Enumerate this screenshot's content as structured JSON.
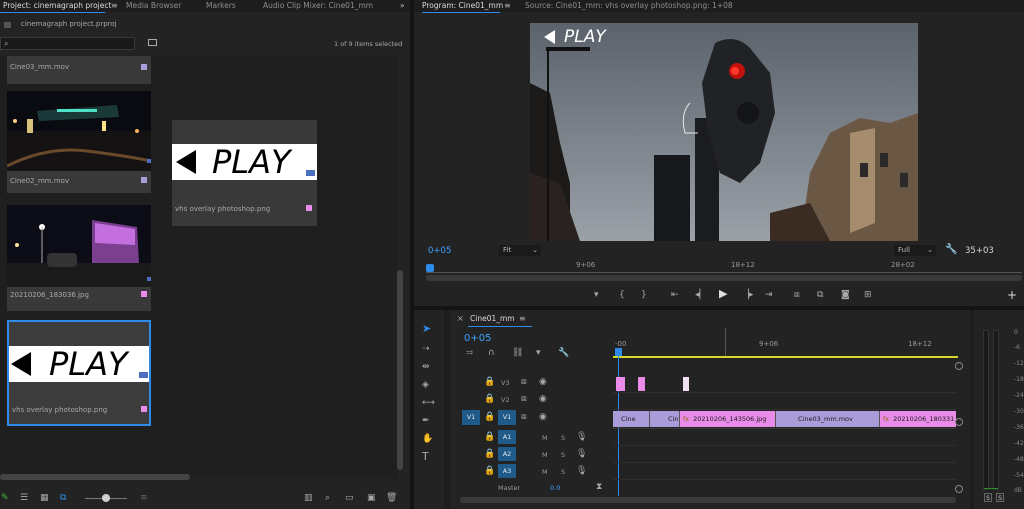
{
  "colors": {
    "accent": "#2d8ceb",
    "pink": "#e98be8",
    "violet": "#a99cd9",
    "timecode": "#3fa2ff",
    "playhead": "#2d8ceb",
    "workarea": "#d6d62b"
  },
  "project": {
    "tabs": [
      "Project: cinemagraph project",
      "Media Browser",
      "Markers",
      "Audio Clip Mixer: Cine01_mm"
    ],
    "more_label": "»",
    "file_name": "cinemagraph project.prproj",
    "search_placeholder": "",
    "items_selected": "1 of 9 items selected",
    "items": [
      {
        "name": "Cine03_mm.mov",
        "color": "#a99cd9",
        "thumb": "cut-off"
      },
      {
        "name": "Cine02_mm.mov",
        "color": "#a99cd9",
        "thumb": "night-street"
      },
      {
        "name": "vhs overlay photoshop.png",
        "color": "#e98be8",
        "thumb": "play-overlay"
      },
      {
        "name": "20210206_183036.jpg",
        "color": "#e98be8",
        "thumb": "purple-building"
      },
      {
        "name": "vhs overlay photoshop.png",
        "color": "#e98be8",
        "thumb": "play-overlay-large",
        "selected": true
      }
    ],
    "play_text": "PLAY"
  },
  "program": {
    "tab": "Program: Cine01_mm",
    "menu_label": "≡",
    "source_tab": "Source: Cine01_mm: vhs overlay photoshop.png: 1+08",
    "play_text": "PLAY",
    "timecode": "0+05",
    "fit": "Fit",
    "quality": "Full",
    "duration": "35+03",
    "ruler": [
      "9+06",
      "18+12",
      "28+02"
    ]
  },
  "timeline": {
    "close_label": "×",
    "tab": "Cine01_mm",
    "menu_label": "≡",
    "timecode": "0+05",
    "ruler": [
      "-00",
      "9+06",
      "18+12"
    ],
    "tracks": [
      {
        "id": "V3",
        "patch": ""
      },
      {
        "id": "V2",
        "patch": ""
      },
      {
        "id": "V1",
        "patch": "V1"
      },
      {
        "id": "A1",
        "patch": ""
      },
      {
        "id": "A2",
        "patch": ""
      },
      {
        "id": "A3",
        "patch": ""
      }
    ],
    "v1_clips": [
      "Cine",
      "Cin",
      "20210206_143506.jpg",
      "Cine03_mm.mov",
      "20210206_180331"
    ],
    "fx_label": "fx",
    "mute": "M",
    "solo": "S",
    "master_label": "Master",
    "master_value": "0.0"
  },
  "meters": {
    "scale": [
      "0",
      "-6",
      "-12",
      "-18",
      "-24",
      "-30",
      "-36",
      "-42",
      "-48",
      "-54",
      "dB"
    ],
    "solo_left": "S",
    "solo_right": "S"
  }
}
